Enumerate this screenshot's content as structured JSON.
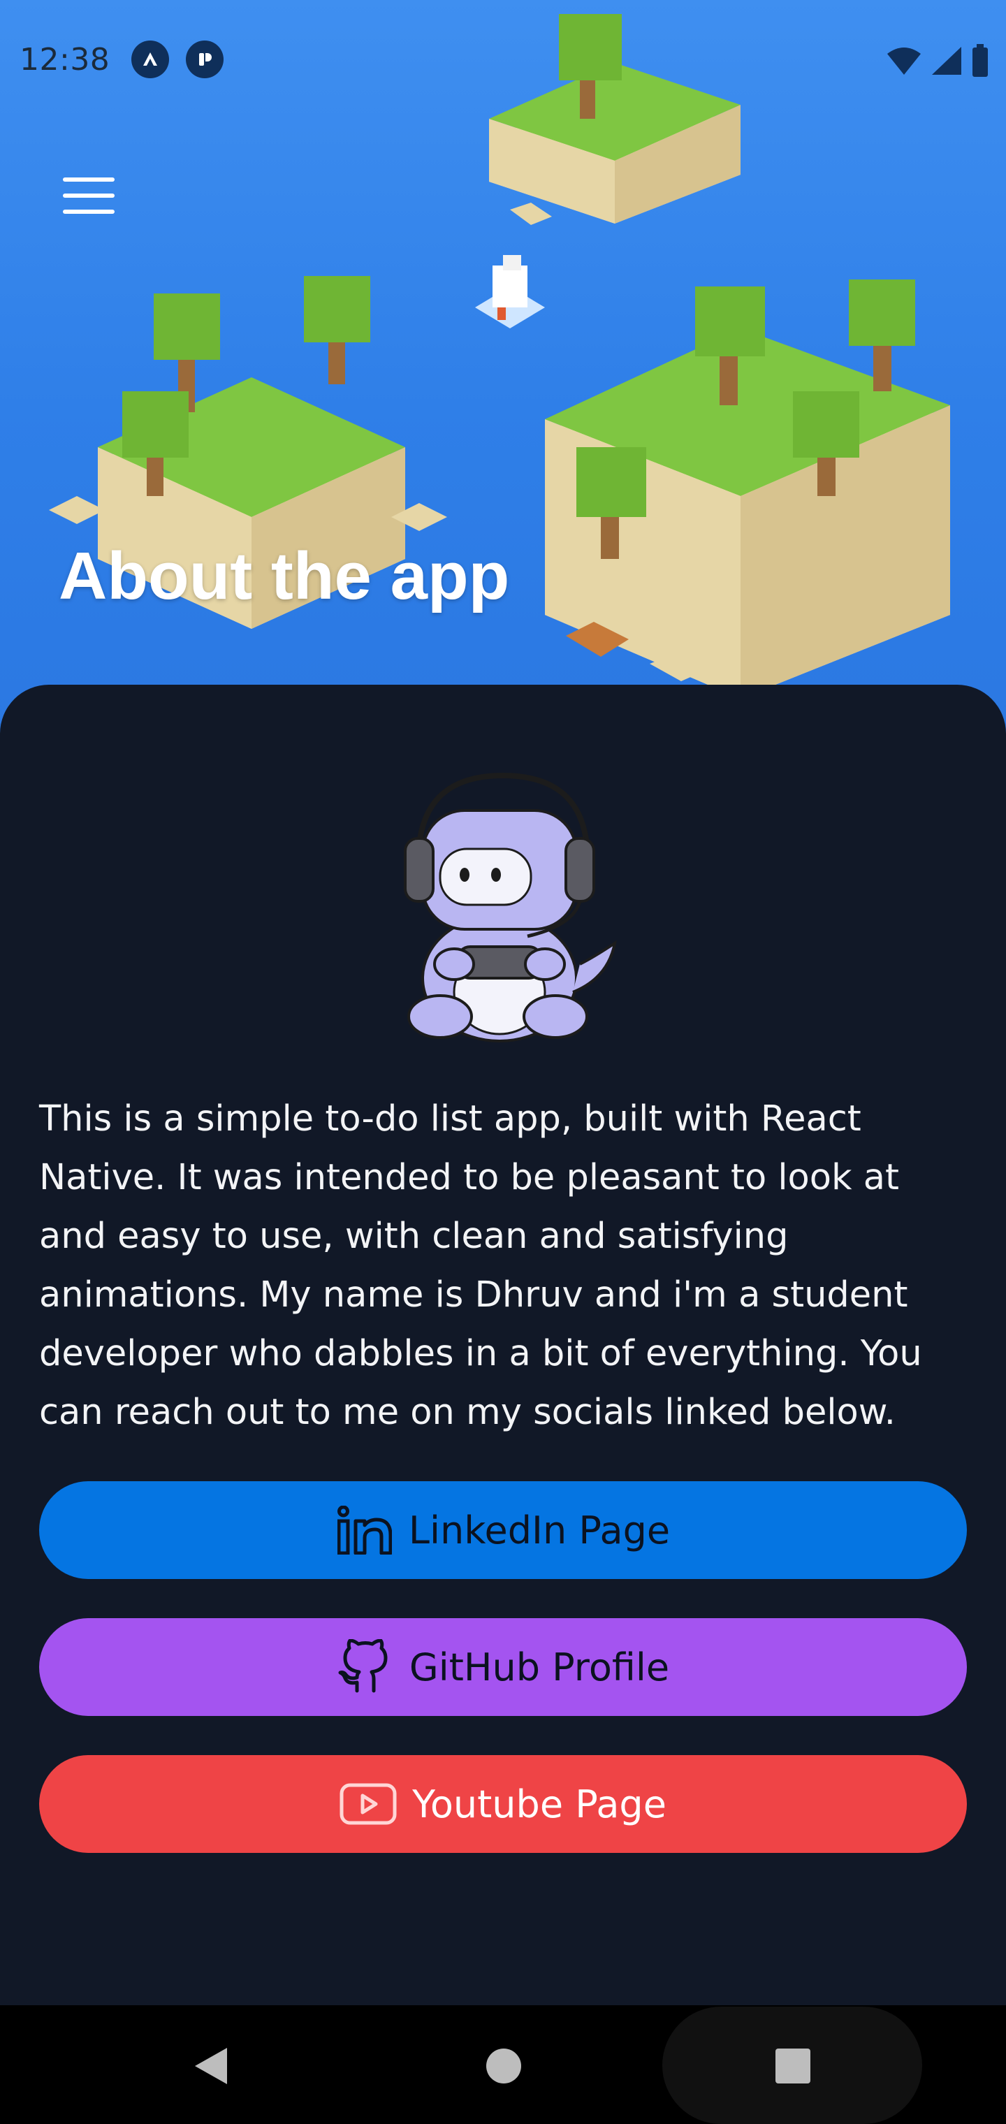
{
  "status_bar": {
    "time": "12:38",
    "left_icons": [
      "expo-icon",
      "app-notification-icon"
    ],
    "right_icons": [
      "wifi-icon",
      "cellular-signal-icon",
      "battery-icon"
    ]
  },
  "header": {
    "menu_icon": "hamburger-menu-icon",
    "title": "About the app",
    "background_colors": {
      "sky": "#3f8ff0",
      "grass": "#7fc642",
      "sand": "#efe3bd",
      "tree_trunk": "#9a6a3a"
    }
  },
  "main": {
    "mascot": "gamer-robot-mascot-illustration",
    "about_text": "This is a simple to-do list app, built with React Native. It was intended to be pleasant to look at and easy to use, with clean and satisfying animations. My name is Dhruv and i'm a student developer who dabbles in a bit of everything. You can reach out to me on my socials linked below.",
    "buttons": [
      {
        "label": "LinkedIn Page",
        "icon": "linkedin-icon",
        "color": "#0575e2"
      },
      {
        "label": "GitHub Profile",
        "icon": "github-icon",
        "color": "#a454f0"
      },
      {
        "label": "Youtube Page",
        "icon": "youtube-icon",
        "color": "#ef4446"
      }
    ],
    "card_color": "#111827"
  },
  "nav_bar": {
    "items": [
      "back-icon",
      "home-icon",
      "recents-icon"
    ]
  }
}
